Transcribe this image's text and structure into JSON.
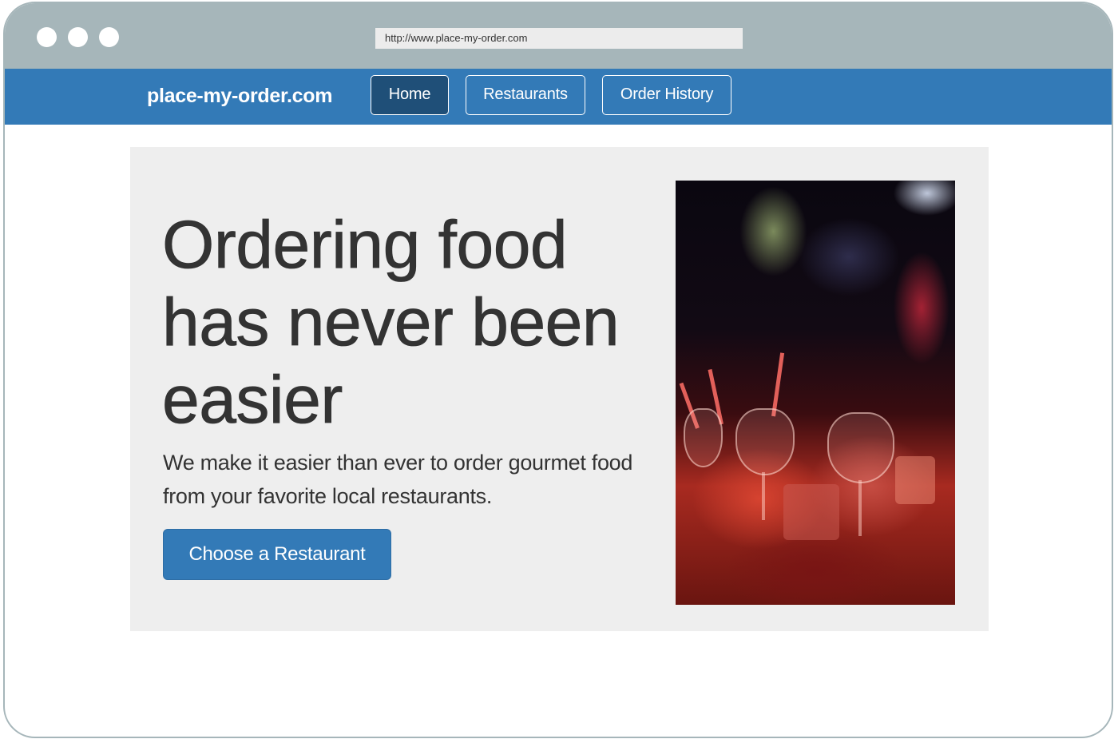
{
  "browser": {
    "url": "http://www.place-my-order.com"
  },
  "navbar": {
    "brand": "place-my-order.com",
    "items": [
      {
        "label": "Home",
        "active": true
      },
      {
        "label": "Restaurants",
        "active": false
      },
      {
        "label": "Order History",
        "active": false
      }
    ]
  },
  "hero": {
    "headline": "Ordering food has never been easier",
    "tagline": "We make it easier than ever to order gourmet food from your favorite local restaurants.",
    "cta_label": "Choose a Restaurant",
    "image_icon": "restaurant-table-photo"
  },
  "colors": {
    "window_chrome": "#a6b6ba",
    "navbar": "#337ab7",
    "active_nav": "#1f4f78",
    "jumbotron_bg": "#eeeeee",
    "text": "#333333"
  }
}
